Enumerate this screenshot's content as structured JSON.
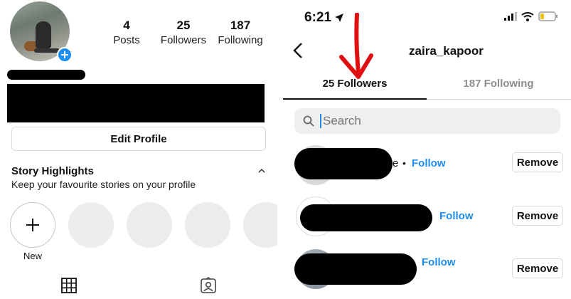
{
  "profile": {
    "stats": [
      {
        "count": "4",
        "label": "Posts"
      },
      {
        "count": "25",
        "label": "Followers"
      },
      {
        "count": "187",
        "label": "Following"
      }
    ],
    "edit_profile_label": "Edit Profile",
    "highlights": {
      "title": "Story Highlights",
      "subtitle": "Keep your favourite stories on your profile",
      "new_label": "New"
    }
  },
  "followers_screen": {
    "status_time": "6:21",
    "username": "zaira_kapoor",
    "tabs": [
      {
        "label": "25 Followers",
        "active": true
      },
      {
        "label": "187 Following",
        "active": false
      }
    ],
    "search_placeholder": "Search",
    "rows": [
      {
        "suffix": "e",
        "separator": "•",
        "follow_label": "Follow",
        "remove_label": "Remove"
      },
      {
        "follow_label": "Follow",
        "remove_label": "Remove"
      },
      {
        "follow_label": "Follow",
        "remove_label": "Remove"
      }
    ]
  },
  "colors": {
    "accent_blue": "#1d8ef0",
    "annotation_red": "#e01010",
    "divider": "#dbdbdb"
  },
  "icons": [
    "plus-icon",
    "chevron-up-icon",
    "grid-icon",
    "tagged-icon",
    "location-arrow-icon",
    "signal-icon",
    "wifi-icon",
    "battery-icon",
    "back-chevron-icon",
    "search-icon"
  ]
}
